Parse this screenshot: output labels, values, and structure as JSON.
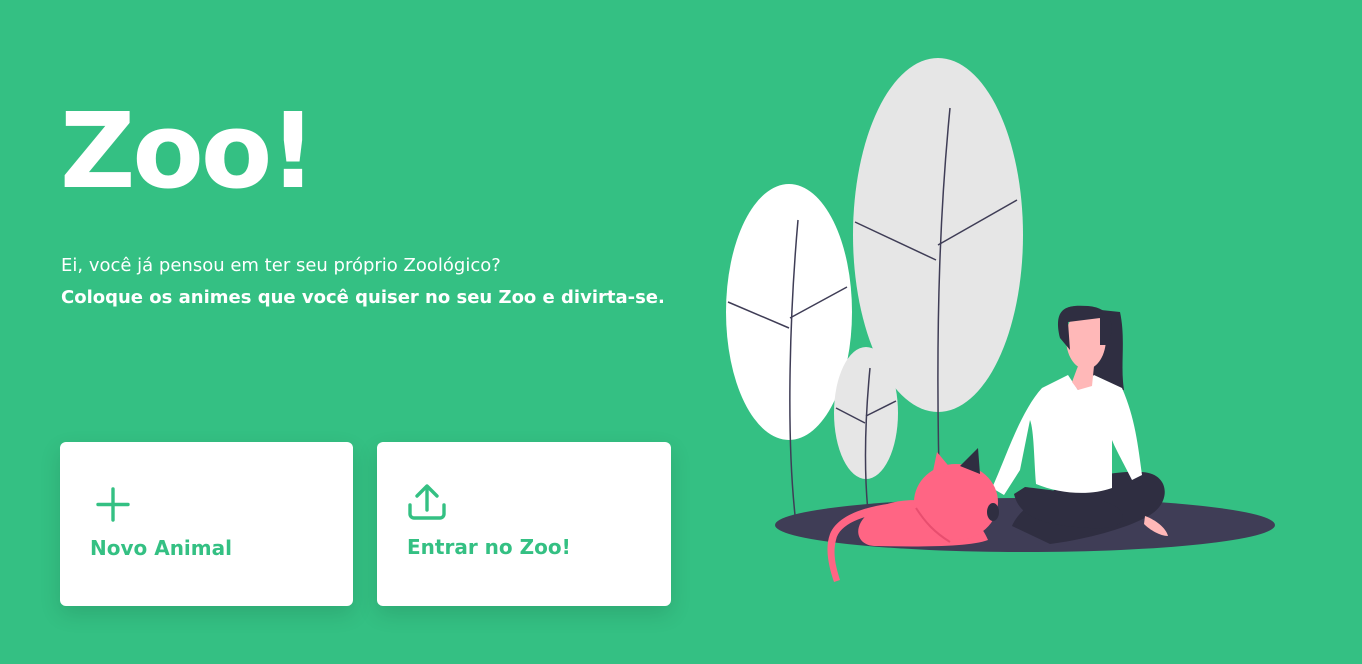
{
  "hero": {
    "title": "Zoo!",
    "subtitle_line1": "Ei, você já pensou em ter seu próprio Zoológico?",
    "subtitle_line2": "Coloque os animes que você quiser no seu Zoo e divirta-se."
  },
  "actions": {
    "new_animal": {
      "label": "Novo Animal",
      "icon": "plus-icon"
    },
    "enter_zoo": {
      "label": "Entrar no Zoo!",
      "icon": "upload-icon"
    }
  },
  "colors": {
    "background": "#34c083",
    "card": "#ffffff",
    "accent": "#34c083",
    "cat": "#ff6584",
    "shadow": "#3f3d56"
  }
}
